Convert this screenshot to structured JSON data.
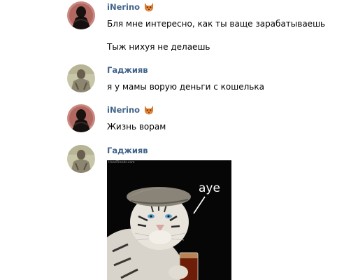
{
  "messages": [
    {
      "author": "iNerino",
      "author_badge": "fox-emoji-icon",
      "lines": [
        "Бля мне интересно, как ты ваще зарабатываешь",
        "Тыж нихуя не делаешь"
      ]
    },
    {
      "author": "Гаджияв",
      "lines": [
        "я у мамы ворую деньги с кошелька"
      ]
    },
    {
      "author": "iNerino",
      "author_badge": "fox-emoji-icon",
      "lines": [
        "Жизнь ворам"
      ]
    },
    {
      "author": "Гаджияв",
      "photo": {
        "watermark": "HeadTrends.com",
        "caption": "aye",
        "subject": "white tiger in flat cap holding a glass of beer"
      }
    }
  ],
  "colors": {
    "author_name": "#42648b",
    "text": "#000000",
    "background": "#ffffff"
  }
}
